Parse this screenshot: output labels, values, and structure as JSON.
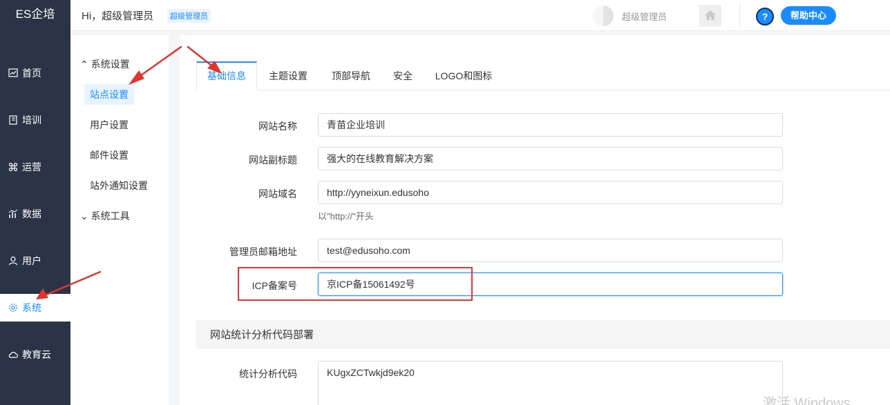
{
  "app": {
    "brand": "ES企培"
  },
  "topbar": {
    "greeting": "Hi，超级管理员",
    "role_badge": "超级管理员",
    "user_name": "超级管理员",
    "help_label": "帮助中心",
    "help_icon_glyph": "?"
  },
  "nav": {
    "items": [
      {
        "label": "首页",
        "icon": "chart-icon"
      },
      {
        "label": "培训",
        "icon": "book-icon"
      },
      {
        "label": "运营",
        "icon": "command-icon"
      },
      {
        "label": "数据",
        "icon": "bar-chart-icon"
      },
      {
        "label": "用户",
        "icon": "user-icon"
      },
      {
        "label": "系统",
        "icon": "gear-icon",
        "active": true
      },
      {
        "label": "教育云",
        "icon": "cloud-icon"
      }
    ]
  },
  "subnav": {
    "group1": "系统设置",
    "items": [
      "站点设置",
      "用户设置",
      "邮件设置",
      "站外通知设置"
    ],
    "group2": "系统工具"
  },
  "tabs": [
    "基础信息",
    "主题设置",
    "顶部导航",
    "安全",
    "LOGO和图标"
  ],
  "form": {
    "site_name_label": "网站名称",
    "site_name_value": "青苗企业培训",
    "subtitle_label": "网站副标题",
    "subtitle_value": "强大的在线教育解决方案",
    "domain_label": "网站域名",
    "domain_value": "http://yyneixun.edusoho",
    "domain_help": "以\"http://\"开头",
    "admin_email_label": "管理员邮箱地址",
    "admin_email_value": "test@edusoho.com",
    "icp_label": "ICP备案号",
    "icp_value": "京ICP备15061492号"
  },
  "analytics": {
    "section_title": "网站统计分析代码部署",
    "code_label": "统计分析代码",
    "code_value": "KUgxZCTwkjd9ek20"
  },
  "watermark": "激活 Windows",
  "colors": {
    "accent": "#1a8cff",
    "sidebar": "#2b3446",
    "annotation": "#e0352f"
  }
}
